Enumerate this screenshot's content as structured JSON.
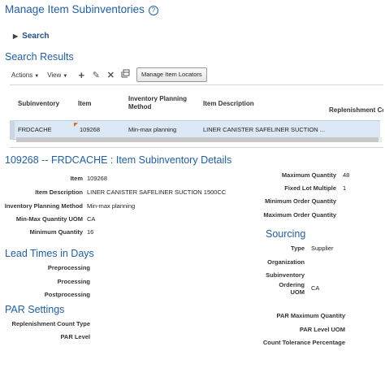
{
  "page": {
    "title": "Manage Item Subinventories",
    "help_glyph": "?"
  },
  "search": {
    "label": "Search"
  },
  "results": {
    "heading": "Search Results",
    "actions_label": "Actions",
    "view_label": "View",
    "manage_locators_label": "Manage Item Locators",
    "columns": {
      "subinventory": "Subinventory",
      "item": "Item",
      "planning_method": "Inventory Planning Method",
      "description": "Item Description",
      "replenishment": "Replenishment Co"
    },
    "rows": [
      {
        "subinventory": "FRDCACHE",
        "item": "109268",
        "planning_method": "Min-max planning",
        "description": "LINER CANISTER SAFELINER SUCTION ..."
      }
    ]
  },
  "details": {
    "heading": "109268 -- FRDCACHE : Item Subinventory Details",
    "left": [
      {
        "label": "Item",
        "value": "109268"
      },
      {
        "label": "Item Description",
        "value": "LINER CANISTER SAFELINER SUCTION 1500CC"
      },
      {
        "label": "Inventory Planning Method",
        "value": "Min-max planning"
      },
      {
        "label": "Min-Max Quantity UOM",
        "value": "CA"
      },
      {
        "label": "Minimum Quantity",
        "value": "16"
      }
    ],
    "right": [
      {
        "label": "Maximum Quantity",
        "value": "48"
      },
      {
        "label": "Fixed Lot Multiple",
        "value": "1"
      },
      {
        "label": "Minimum Order Quantity",
        "value": ""
      },
      {
        "label": "Maximum Order Quantity",
        "value": ""
      }
    ]
  },
  "lead_times": {
    "heading": "Lead Times in Days",
    "labels": [
      "Preprocessing",
      "Processing",
      "Postprocessing"
    ]
  },
  "sourcing": {
    "heading": "Sourcing",
    "type_label": "Type",
    "type_value": "Supplier",
    "organization_label": "Organization",
    "subinventory_label": "Subinventory",
    "ordering_uom_label_1": "Ordering",
    "ordering_uom_label_2": "UOM",
    "ordering_uom_value": "CA"
  },
  "par": {
    "heading": "PAR Settings",
    "left_labels": [
      "Replenishment Count Type",
      "PAR Level"
    ],
    "right_labels": [
      "PAR Maximum Quantity",
      "PAR Level UOM",
      "Count Tolerance Percentage"
    ]
  },
  "colors": {
    "heading_blue": "#1f5fa8",
    "selected_row": "#dce8f5",
    "flag_orange": "#e86b1b"
  }
}
